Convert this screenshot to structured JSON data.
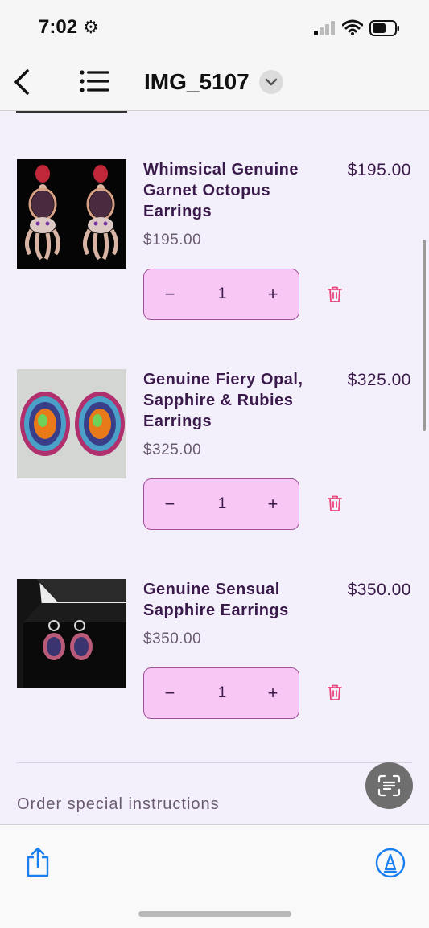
{
  "status_bar": {
    "time": "7:02",
    "settings_icon": "gear-icon",
    "signal_icon": "cellular-signal-icon",
    "wifi_icon": "wifi-icon",
    "battery_icon": "battery-icon"
  },
  "toolbar": {
    "title": "IMG_5107",
    "back_icon": "chevron-left-icon",
    "list_icon": "list-icon",
    "title_menu_icon": "chevron-down-icon"
  },
  "cart": {
    "items": [
      {
        "name": "Whimsical Genuine Garnet Octopus Earrings",
        "price": "$195.00",
        "total": "$195.00",
        "quantity": "1",
        "minus": "−",
        "plus": "+"
      },
      {
        "name": "Genuine Fiery Opal, Sapphire & Rubies Earrings",
        "price": "$325.00",
        "total": "$325.00",
        "quantity": "1",
        "minus": "−",
        "plus": "+"
      },
      {
        "name": "Genuine Sensual Sapphire Earrings",
        "price": "$350.00",
        "total": "$350.00",
        "quantity": "1",
        "minus": "−",
        "plus": "+"
      }
    ],
    "instructions_label": "Order special instructions"
  },
  "bottom_bar": {
    "share_icon": "share-icon",
    "markup_icon": "markup-pen-icon",
    "live_text_icon": "live-text-scan-icon"
  },
  "colors": {
    "qty_fill": "#f8c7f4",
    "qty_border": "#a0509a",
    "trash": "#e8467c",
    "accent_blue": "#1a7ff0",
    "text_dark": "#3a1a4a"
  }
}
